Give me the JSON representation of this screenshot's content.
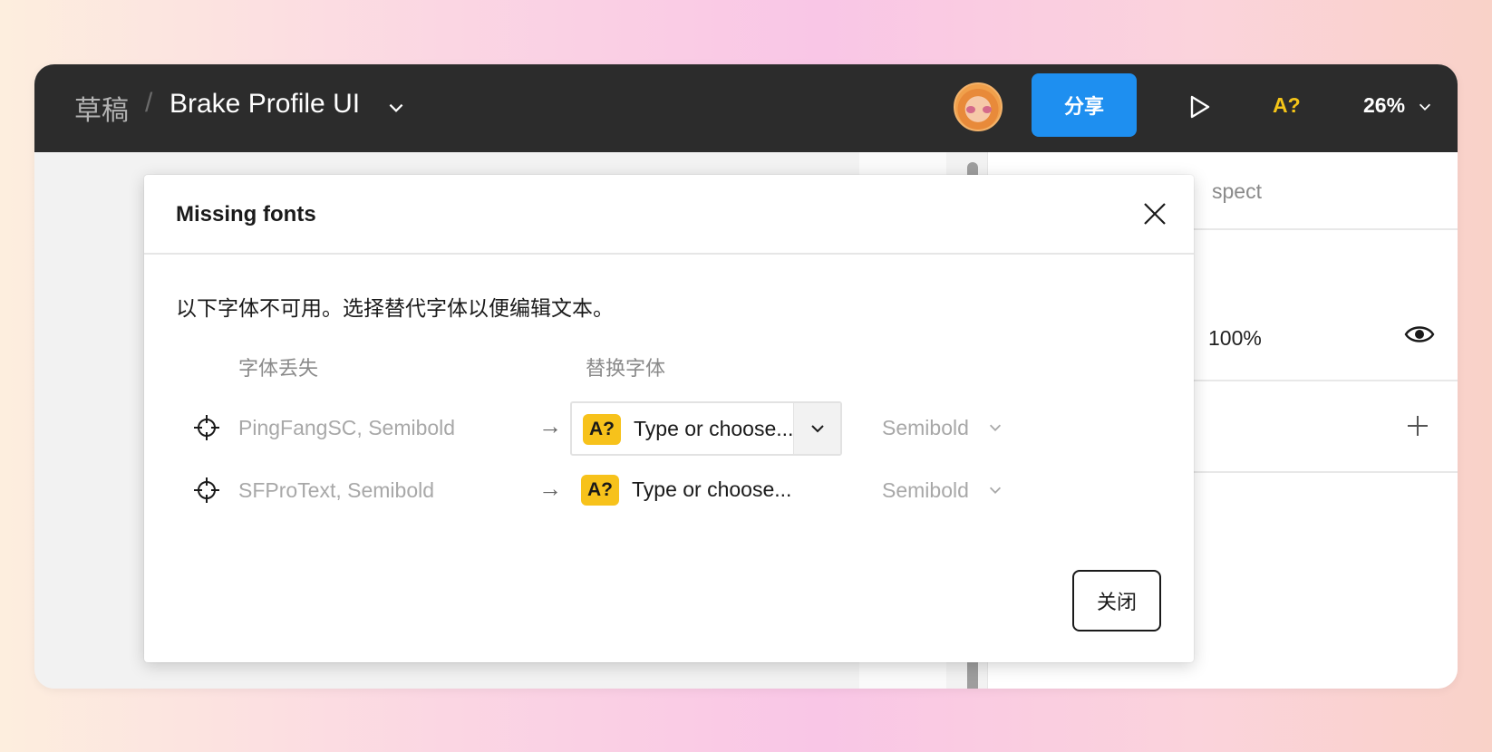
{
  "topbar": {
    "breadcrumb_root": "草稿",
    "breadcrumb_separator": "/",
    "file_name": "Brake Profile UI",
    "share_label": "分享",
    "missing_font_indicator": "A?",
    "zoom_level": "26%"
  },
  "right_panel": {
    "tab_label": "spect",
    "opacity_value": "100%"
  },
  "modal": {
    "title": "Missing fonts",
    "description": "以下字体不可用。选择替代字体以便编辑文本。",
    "column_missing": "字体丢失",
    "column_replace": "替换字体",
    "rows": [
      {
        "missing_font": "PingFangSC, Semibold",
        "badge": "A?",
        "replacement_placeholder": "Type or choose...",
        "weight": "Semibold"
      },
      {
        "missing_font": "SFProText, Semibold",
        "badge": "A?",
        "replacement_placeholder": "Type or choose...",
        "weight": "Semibold"
      }
    ],
    "close_label": "关闭"
  },
  "colors": {
    "topbar_bg": "#2c2c2c",
    "share_button": "#1e8ff0",
    "font_warning": "#f5c518",
    "badge_bg": "#f7c21b"
  }
}
